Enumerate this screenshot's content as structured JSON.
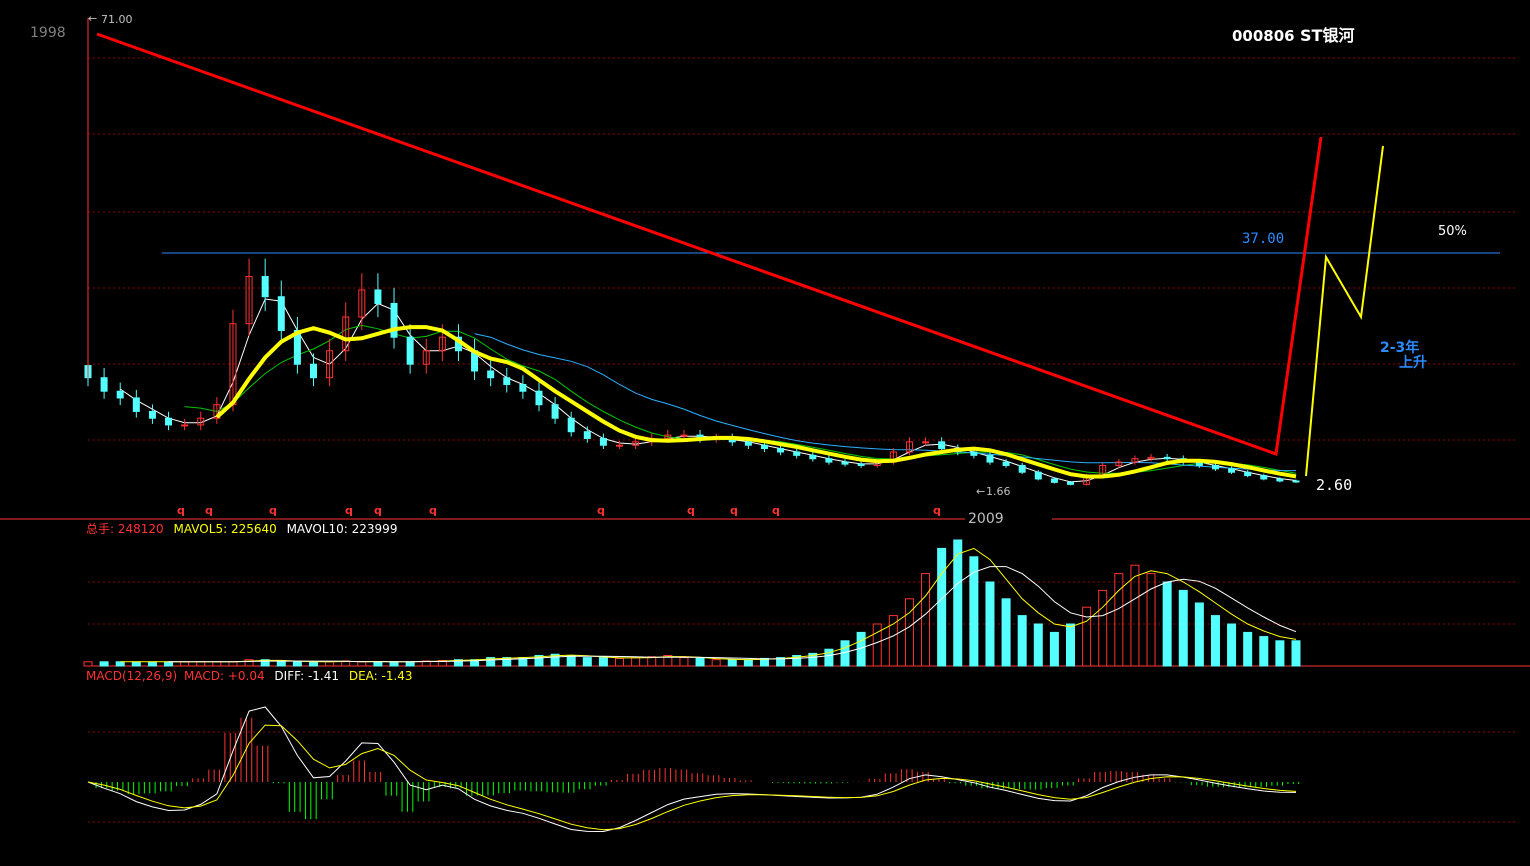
{
  "header": {
    "stock_code": "000806",
    "stock_name": "ST银河",
    "start_year": "1998",
    "end_year": "2009"
  },
  "price_panel": {
    "high_label": "71.00",
    "low_label": "1.66",
    "current_label": "2.60",
    "level_label": "37.00",
    "percent_label": "50%",
    "forecast_label_1": "2-3年",
    "forecast_label_2": "上升",
    "marker_char": "q"
  },
  "volume_panel": {
    "total_label": "总手",
    "total_value": "248120",
    "mavol5_label": "MAVOL5",
    "mavol5_value": "225640",
    "mavol10_label": "MAVOL10",
    "mavol10_value": "223999"
  },
  "macd_panel": {
    "name": "MACD(12,26,9)",
    "macd_label": "MACD",
    "macd_value": "+0.04",
    "diff_label": "DIFF",
    "diff_value": "-1.41",
    "dea_label": "DEA",
    "dea_value": "-1.43"
  },
  "colors": {
    "up": "#ff3232",
    "down": "#54ffff",
    "ma_thick": "#ffff00",
    "trend_red": "#ff0000",
    "forecast_yellow": "#ffff00",
    "level_line": "#2a8cff",
    "grid": "#8b0000",
    "macd_neg": "#00ff00"
  },
  "chart_data": [
    {
      "type": "candlestick",
      "title": "000806 ST银河",
      "x_range": [
        "1998",
        "2009"
      ],
      "high": 71.0,
      "low": 1.66,
      "last": 2.6,
      "horizontal_level": 37.0,
      "annotations": [
        "71.00",
        "1.66",
        "2.60",
        "37.00",
        "50%",
        "2-3年 上升"
      ],
      "closes_approx": [
        18,
        16,
        15,
        13,
        12,
        11,
        11,
        12,
        14,
        26,
        33,
        30,
        25,
        20,
        18,
        22,
        27,
        31,
        29,
        24,
        20,
        22,
        24,
        22,
        19,
        18,
        17,
        16,
        14,
        12,
        10,
        9,
        8,
        8,
        8.5,
        9,
        9.5,
        9.5,
        9,
        9,
        8.5,
        8,
        7.5,
        7,
        6.5,
        6,
        5.5,
        5.2,
        5,
        5.5,
        7,
        8.5,
        8.5,
        7.5,
        7,
        6.5,
        5.5,
        5,
        4,
        3,
        2.5,
        2.2,
        3.5,
        5,
        5.5,
        6,
        6.2,
        6,
        5.5,
        5,
        4.5,
        4,
        3.5,
        3,
        2.7,
        2.6
      ]
    },
    {
      "type": "bar",
      "title": "总手",
      "series": [
        {
          "name": "总手",
          "value": 248120
        },
        {
          "name": "MAVOL5",
          "value": 225640
        },
        {
          "name": "MAVOL10",
          "value": 223999
        }
      ],
      "volume_approx": [
        1,
        1,
        1,
        1,
        1,
        1,
        1,
        1,
        1,
        1,
        1.5,
        1.5,
        1,
        1,
        1,
        1,
        1.2,
        1,
        1,
        1,
        1,
        1.2,
        1.3,
        1.5,
        1.5,
        2,
        2,
        2,
        2.5,
        2.8,
        2.5,
        2,
        2,
        1.8,
        2,
        2.2,
        2.5,
        2,
        1.8,
        1.5,
        1.5,
        1.5,
        1.8,
        2,
        2.5,
        3,
        4,
        6,
        8,
        10,
        12,
        16,
        22,
        28,
        30,
        26,
        20,
        16,
        12,
        10,
        8,
        10,
        14,
        18,
        22,
        24,
        22,
        20,
        18,
        15,
        12,
        10,
        8,
        7,
        6,
        6
      ]
    },
    {
      "type": "bar",
      "title": "MACD(12,26,9)",
      "series": [
        {
          "name": "MACD",
          "value": 0.04
        },
        {
          "name": "DIFF",
          "value": -1.41
        },
        {
          "name": "DEA",
          "value": -1.43
        }
      ]
    }
  ]
}
